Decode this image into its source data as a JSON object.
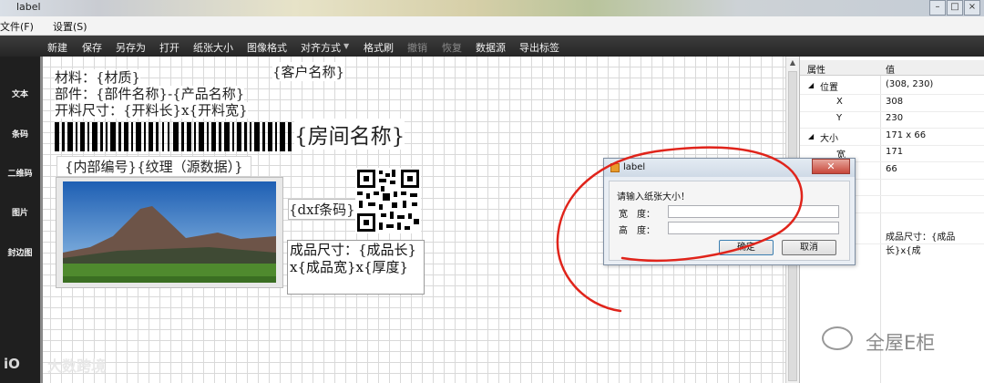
{
  "window": {
    "title": "label"
  },
  "menu": {
    "items": [
      "文件(F)",
      "设置(S)"
    ]
  },
  "toolbar": {
    "items": [
      {
        "label": "新建",
        "enabled": true
      },
      {
        "label": "保存",
        "enabled": true
      },
      {
        "label": "另存为",
        "enabled": true
      },
      {
        "label": "打开",
        "enabled": true
      },
      {
        "label": "纸张大小",
        "enabled": true
      },
      {
        "label": "图像格式",
        "enabled": true
      },
      {
        "label": "对齐方式",
        "enabled": true
      },
      {
        "label": "格式刷",
        "enabled": true
      },
      {
        "label": "撤销",
        "enabled": false
      },
      {
        "label": "恢复",
        "enabled": false
      },
      {
        "label": "数据源",
        "enabled": true
      },
      {
        "label": "导出标签",
        "enabled": true
      }
    ]
  },
  "sidebar": {
    "items": [
      "文本",
      "条码",
      "二维码",
      "图片",
      "封边图"
    ]
  },
  "canvas": {
    "customer": "{客户名称}",
    "material": "材料：{材质}",
    "part": "部件：{部件名称}-{产品名称}",
    "cut_size": "开料尺寸：{开料长}x{开料宽}",
    "room": "{房间名称}",
    "internal": "{内部编号}{纹理（源数据）}",
    "dxf": "{dxf条码}",
    "finished": "成品尺寸：{成品长}x{成品宽}x{厚度}"
  },
  "properties": {
    "headers": {
      "name": "属性",
      "value": "值"
    },
    "position": {
      "label": "位置",
      "value": "(308, 230)"
    },
    "x": {
      "label": "X",
      "value": "308"
    },
    "y": {
      "label": "Y",
      "value": "230"
    },
    "size": {
      "label": "大小",
      "value": "171 x 66"
    },
    "width": {
      "label": "宽",
      "value": "171"
    },
    "height": {
      "value": "66"
    },
    "text_value": "成品尺寸：{成品长}x{成"
  },
  "dialog": {
    "title": "label",
    "prompt": "请输入纸张大小！",
    "width_label": "宽　度：",
    "height_label": "高　度：",
    "width_value": "",
    "height_value": "",
    "ok": "确定",
    "cancel": "取消"
  },
  "watermarks": {
    "right": "全屋E柜",
    "left": "大数跨境"
  },
  "colors": {
    "toolbar_bg": "#2e2e2e",
    "sidebar_bg": "#1f1f1f",
    "annotation": "#e0241b"
  }
}
